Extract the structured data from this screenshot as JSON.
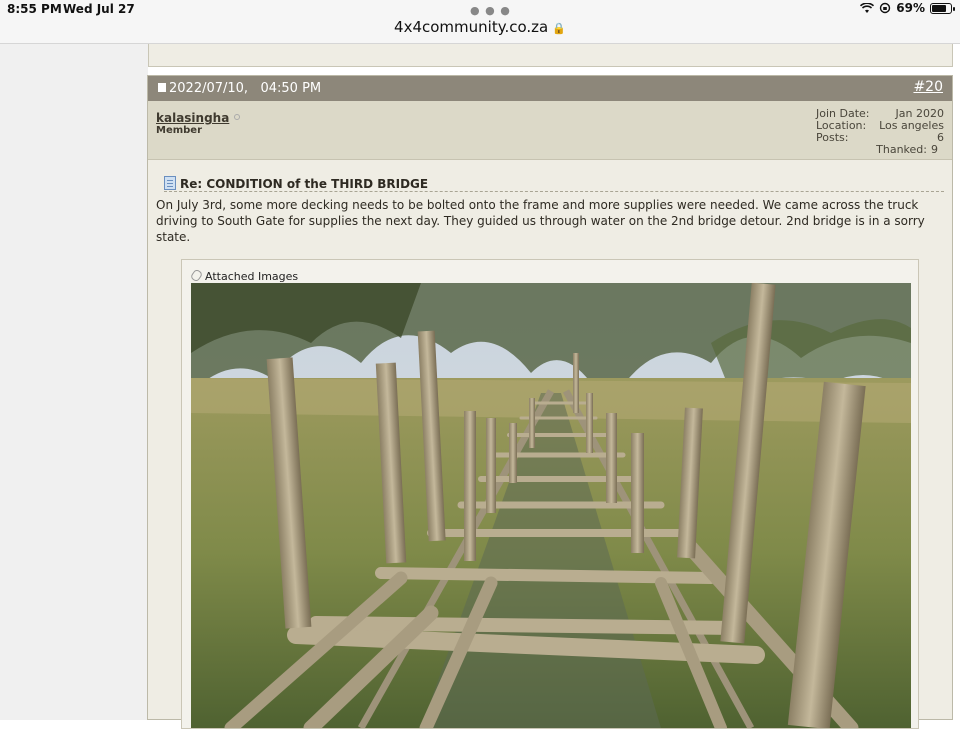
{
  "status_bar": {
    "time": "8:55 PM",
    "date": "Wed Jul 27",
    "battery": "69%"
  },
  "browser": {
    "url": "4x4community.co.za"
  },
  "post": {
    "date": "2022/07/10,",
    "time": "04:50 PM",
    "number": "#20",
    "user": {
      "name": "kalasingha",
      "title": "Member"
    },
    "user_info": [
      {
        "label": "Join Date:",
        "value": "Jan 2020"
      },
      {
        "label": "Location:",
        "value": "Los angeles"
      },
      {
        "label": "Posts:",
        "value": "6"
      }
    ],
    "thanked": {
      "label": "Thanked:",
      "value": "9"
    },
    "title": "Re: CONDITION of the THIRD BRIDGE",
    "body": "On July 3rd, some more decking needs to be bolted onto the frame and more supplies were needed. We came across the truck driving to South Gate for supplies the next day. They guided us through water on the 2nd bridge detour. 2nd bridge is in a sorry state.",
    "attachments_label": "Attached Images"
  },
  "colors": {
    "header_bar": "#8d877a",
    "user_bar": "#dcd9c8",
    "post_bg": "#efede4"
  }
}
